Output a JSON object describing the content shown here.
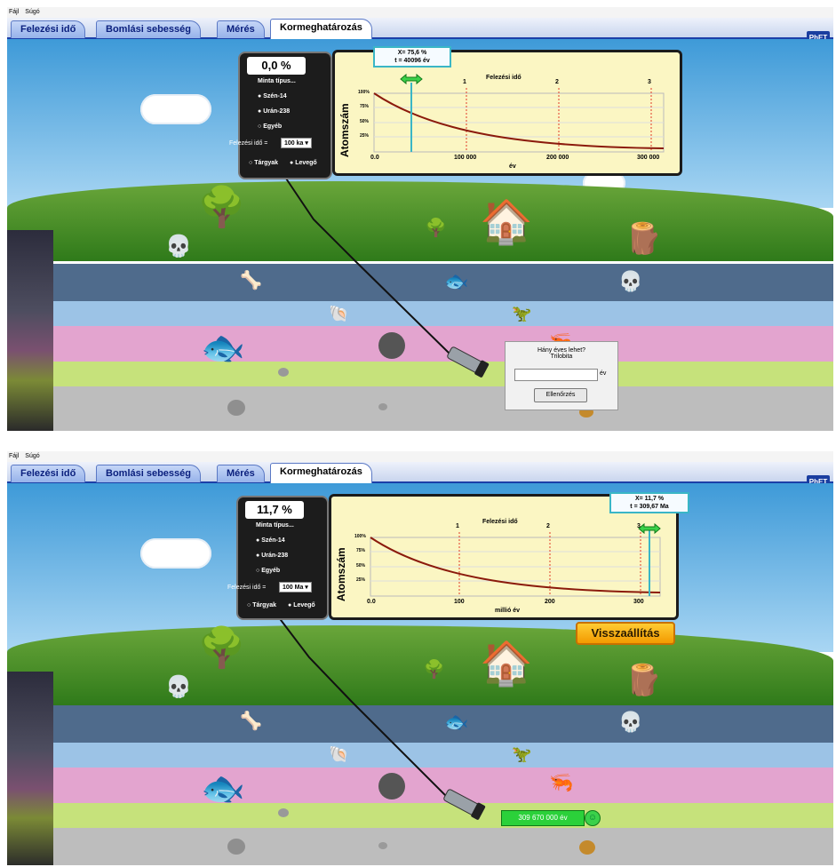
{
  "menu": [
    "Fájl",
    "Súgó"
  ],
  "tabs": [
    "Felezési idő",
    "Bomlási sebesség",
    "Mérés",
    "Kormeghatározás"
  ],
  "active_tab": "Kormeghatározás",
  "logo_text": "PhET",
  "panel1": {
    "percent": "0,0 %",
    "sample_type_label": "Minta típus...",
    "options": [
      "Szén-14",
      "Urán-238",
      "Egyéb"
    ],
    "halflife_label": "Felezési idő =",
    "halflife_value": "100 ka",
    "object_options": [
      "Tárgyak",
      "Levegő"
    ],
    "graph": {
      "title": "Felezési idő",
      "ylabel": "Atomszám",
      "xlabel": "év",
      "x_ticks": [
        "0.0",
        "100 000",
        "200 000",
        "300 000"
      ],
      "y_ticks": [
        "100%",
        "75%",
        "50%",
        "25%"
      ],
      "halflife_markers": [
        "1",
        "2",
        "3"
      ],
      "callout_x": "X= 75,6 %",
      "callout_t": "t = 40096 év"
    },
    "dialog": {
      "question": "Hány éves lehet?",
      "object": "Trilobita",
      "unit": "év",
      "check_button": "Ellenőrzés",
      "input_value": ""
    }
  },
  "panel2": {
    "percent": "11,7 %",
    "sample_type_label": "Minta típus...",
    "options": [
      "Szén-14",
      "Urán-238",
      "Egyéb"
    ],
    "halflife_label": "Felezési idő =",
    "halflife_value": "100 Ma",
    "object_options": [
      "Tárgyak",
      "Levegő"
    ],
    "graph": {
      "title": "Felezési idő",
      "ylabel": "Atomszám",
      "xlabel": "millió év",
      "x_ticks": [
        "0.0",
        "100",
        "200",
        "300"
      ],
      "y_ticks": [
        "100%",
        "75%",
        "50%",
        "25%"
      ],
      "halflife_markers": [
        "1",
        "2",
        "3"
      ],
      "callout_x": "X= 11,7 %",
      "callout_t": "t = 309,67 Ma"
    },
    "reset_button": "Visszaállítás",
    "readout": "309 670 000 év"
  },
  "colors": {
    "tab_blue": "#1b3fa8",
    "graph_bg": "#fbf6c3",
    "curve": "#8b1a0c",
    "marker": "#e03a2a",
    "callout": "#3ab6c6",
    "ok_green": "#2bd13a",
    "reset_orange": "#f5a300"
  }
}
